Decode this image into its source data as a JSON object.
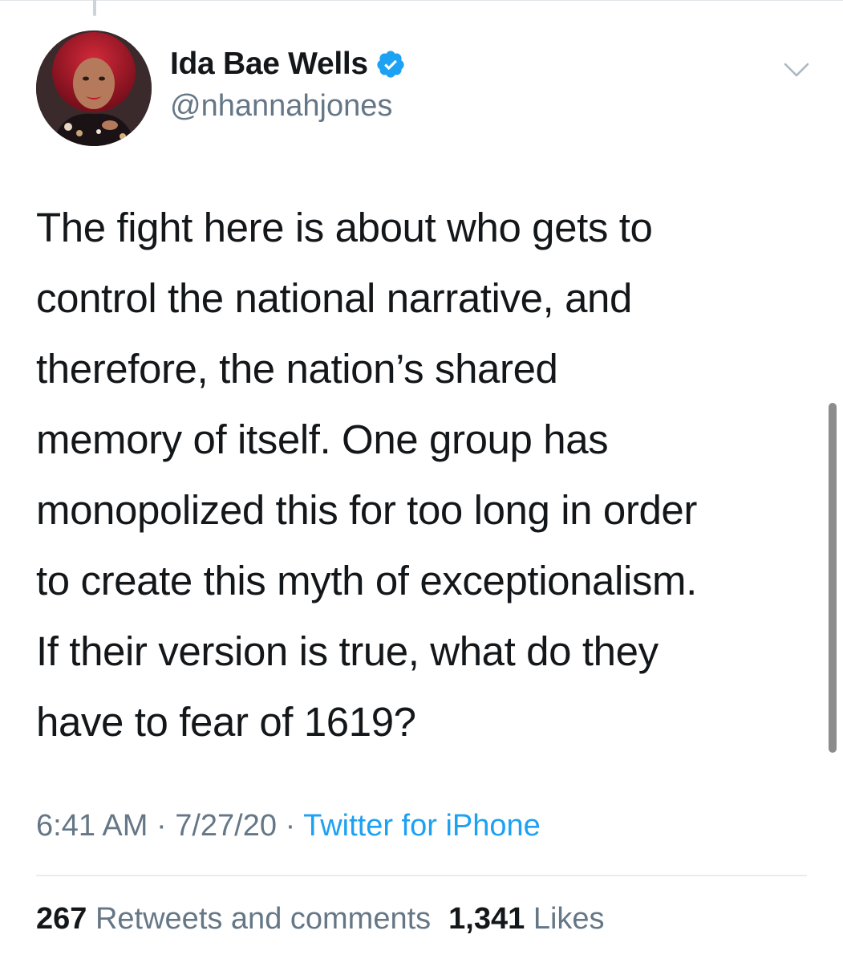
{
  "tweet": {
    "author": {
      "display_name": "Ida Bae Wells",
      "handle": "@nhannahjones",
      "verified": true
    },
    "text_lines": [
      "The fight here is about who gets to",
      "control the national narrative, and",
      "therefore, the nation’s shared",
      "memory of itself. One group has",
      "monopolized this for too long in order",
      "to create this myth of exceptionalism.",
      "If their version is true, what do they",
      "have to fear of 1619?"
    ],
    "time": "6:41 AM",
    "date": "7/27/20",
    "separator": "·",
    "source": "Twitter for iPhone",
    "stats": {
      "retweets_count": "267",
      "retweets_label": "Retweets and comments",
      "likes_count": "1,341",
      "likes_label": "Likes"
    }
  },
  "icons": {
    "verified": "verified-badge-icon",
    "more": "chevron-down-icon"
  },
  "colors": {
    "text_primary": "#14171a",
    "text_secondary": "#657786",
    "link_blue": "#1da1f2",
    "divider": "#e6ecf0",
    "scrollbar": "#8c8c8c"
  }
}
